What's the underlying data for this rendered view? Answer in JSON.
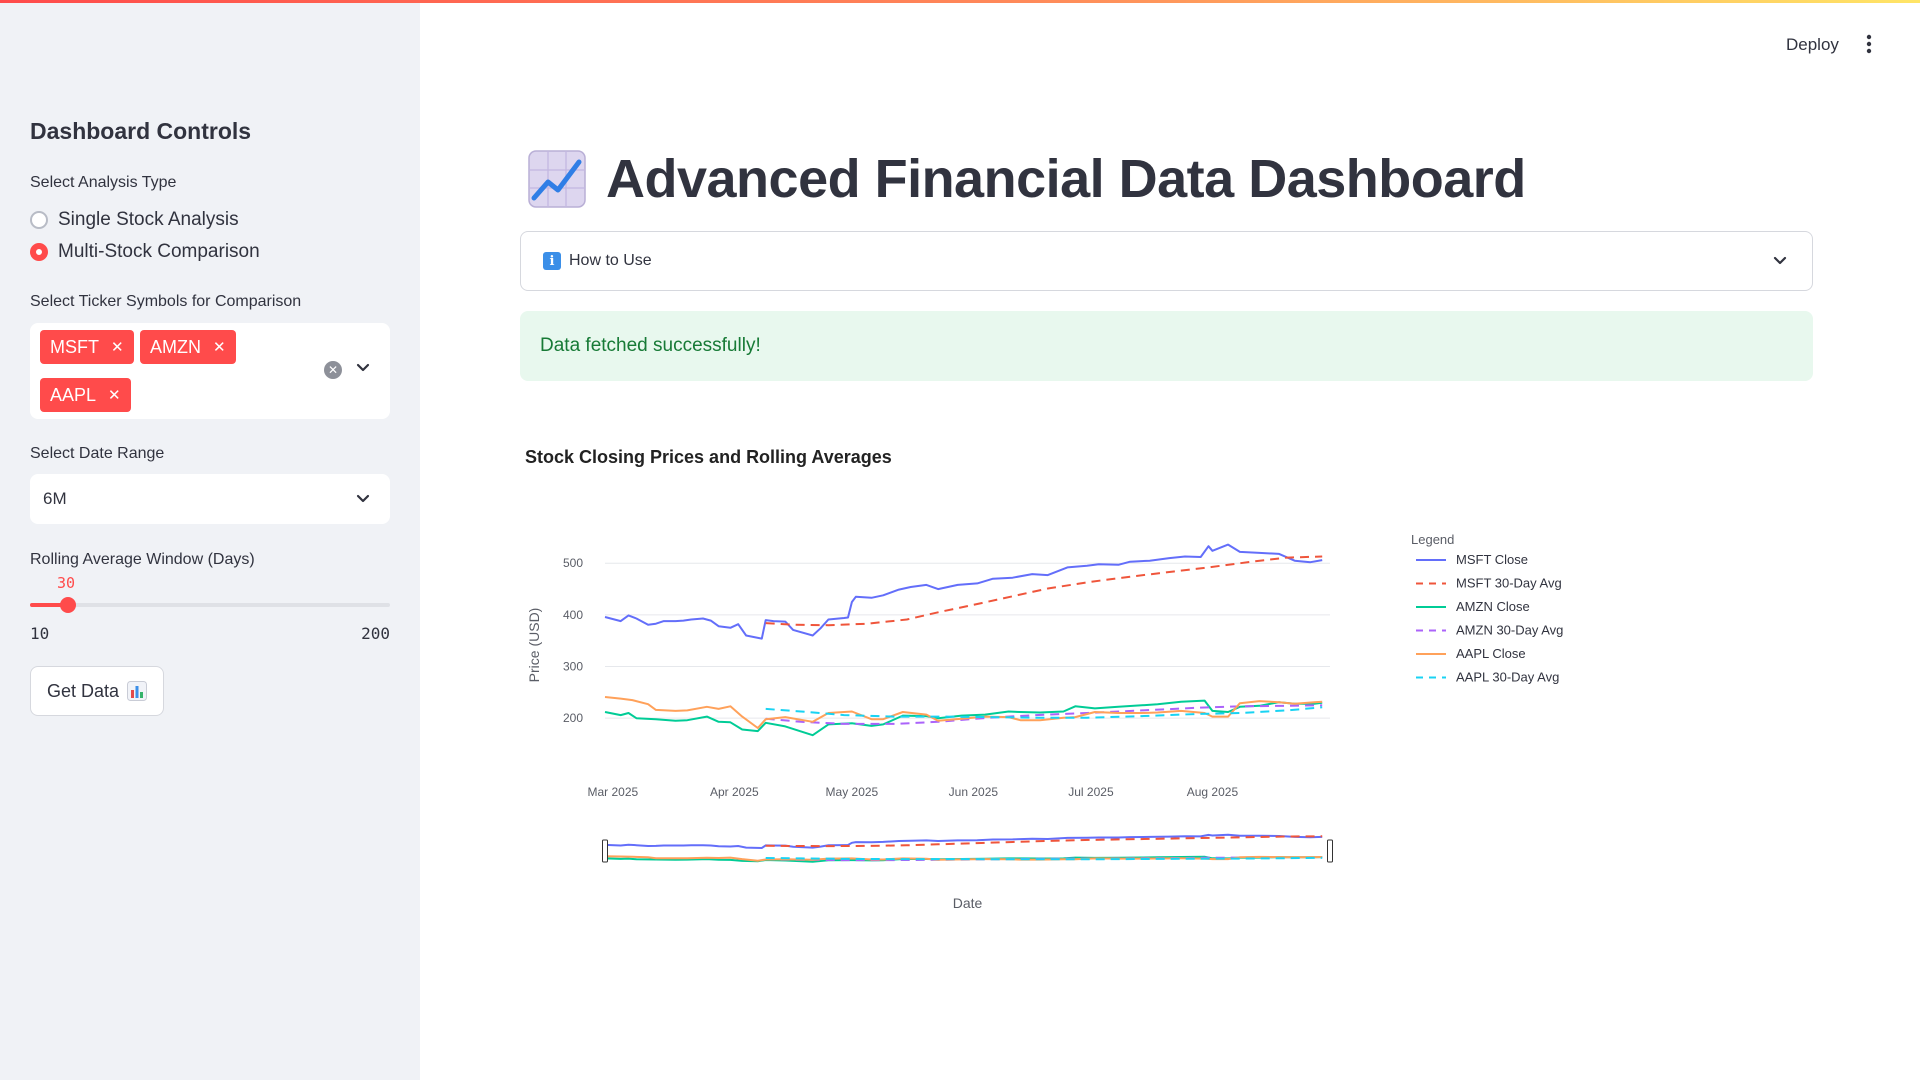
{
  "sidebar": {
    "title": "Dashboard Controls",
    "analysis_label": "Select Analysis Type",
    "analysis_options": [
      "Single Stock Analysis",
      "Multi-Stock Comparison"
    ],
    "analysis_selected": "Multi-Stock Comparison",
    "ticker_label": "Select Ticker Symbols for Comparison",
    "tickers": [
      "MSFT",
      "AMZN",
      "AAPL"
    ],
    "tag_remove_glyph": "✕",
    "clear_glyph": "✕",
    "date_range_label": "Select Date Range",
    "date_range_value": "6M",
    "rolling_label": "Rolling Average Window (Days)",
    "rolling_value": "30",
    "rolling_min": "10",
    "rolling_max": "200",
    "button_label": "Get Data",
    "button_icon": "bar-chart-icon"
  },
  "header": {
    "deploy_label": "Deploy",
    "menu_icon": "kebab-menu-icon"
  },
  "main": {
    "title": "Advanced Financial Data Dashboard",
    "title_icon": "chart-increasing-icon",
    "expander_label": "How to Use",
    "expander_info_glyph": "i",
    "success_message": "Data fetched successfully!",
    "chart_title": "Stock Closing Prices and Rolling Averages"
  },
  "colors": {
    "accent": "#ff4b4b",
    "sidebar_bg": "#f0f2f6",
    "success_bg": "#e8f8ee",
    "success_text": "#177a36",
    "msft": "#636efa",
    "msft_avg": "#ef553b",
    "amzn": "#00cc96",
    "amzn_avg": "#ab63fa",
    "aapl": "#ffa15a",
    "aapl_avg": "#19d3f3"
  },
  "chart_data": {
    "type": "line",
    "title": "Stock Closing Prices and Rolling Averages",
    "xlabel": "Date",
    "ylabel": "Price (USD)",
    "x_ticks": [
      "Mar 2025",
      "Apr 2025",
      "May 2025",
      "Jun 2025",
      "Jul 2025",
      "Aug 2025"
    ],
    "y_ticks": [
      200,
      300,
      400,
      500
    ],
    "ylim": [
      150,
      545
    ],
    "xlim": [
      "2025-02-27",
      "2025-08-31"
    ],
    "grid": true,
    "legend_title": "Legend",
    "legend_position": "right",
    "range_slider": true,
    "series": [
      {
        "name": "MSFT Close",
        "dash": false,
        "color": "#636efa",
        "points": [
          [
            "2025-02-27",
            396
          ],
          [
            "2025-03-03",
            388
          ],
          [
            "2025-03-05",
            399
          ],
          [
            "2025-03-07",
            393
          ],
          [
            "2025-03-10",
            381
          ],
          [
            "2025-03-12",
            383
          ],
          [
            "2025-03-14",
            388
          ],
          [
            "2025-03-17",
            388
          ],
          [
            "2025-03-19",
            389
          ],
          [
            "2025-03-21",
            391
          ],
          [
            "2025-03-24",
            393
          ],
          [
            "2025-03-26",
            389
          ],
          [
            "2025-03-28",
            378
          ],
          [
            "2025-03-31",
            375
          ],
          [
            "2025-04-02",
            382
          ],
          [
            "2025-04-04",
            360
          ],
          [
            "2025-04-08",
            354
          ],
          [
            "2025-04-09",
            390
          ],
          [
            "2025-04-11",
            388
          ],
          [
            "2025-04-14",
            387
          ],
          [
            "2025-04-16",
            371
          ],
          [
            "2025-04-21",
            360
          ],
          [
            "2025-04-23",
            374
          ],
          [
            "2025-04-25",
            391
          ],
          [
            "2025-04-29",
            394
          ],
          [
            "2025-04-30",
            395
          ],
          [
            "2025-05-01",
            425
          ],
          [
            "2025-05-02",
            435
          ],
          [
            "2025-05-06",
            433
          ],
          [
            "2025-05-09",
            438
          ],
          [
            "2025-05-13",
            449
          ],
          [
            "2025-05-16",
            454
          ],
          [
            "2025-05-20",
            458
          ],
          [
            "2025-05-23",
            450
          ],
          [
            "2025-05-28",
            458
          ],
          [
            "2025-06-02",
            461
          ],
          [
            "2025-06-06",
            470
          ],
          [
            "2025-06-11",
            472
          ],
          [
            "2025-06-16",
            479
          ],
          [
            "2025-06-20",
            477
          ],
          [
            "2025-06-25",
            492
          ],
          [
            "2025-06-30",
            495
          ],
          [
            "2025-07-03",
            498
          ],
          [
            "2025-07-08",
            497
          ],
          [
            "2025-07-11",
            503
          ],
          [
            "2025-07-16",
            505
          ],
          [
            "2025-07-21",
            510
          ],
          [
            "2025-07-25",
            513
          ],
          [
            "2025-07-29",
            512
          ],
          [
            "2025-07-31",
            533
          ],
          [
            "2025-08-01",
            524
          ],
          [
            "2025-08-05",
            536
          ],
          [
            "2025-08-08",
            522
          ],
          [
            "2025-08-13",
            520
          ],
          [
            "2025-08-18",
            518
          ],
          [
            "2025-08-22",
            505
          ],
          [
            "2025-08-26",
            502
          ],
          [
            "2025-08-29",
            506
          ]
        ]
      },
      {
        "name": "MSFT 30-Day Avg",
        "dash": true,
        "color": "#ef553b",
        "points": [
          [
            "2025-04-09",
            384
          ],
          [
            "2025-04-16",
            381
          ],
          [
            "2025-04-25",
            380
          ],
          [
            "2025-05-05",
            383
          ],
          [
            "2025-05-15",
            391
          ],
          [
            "2025-05-23",
            405
          ],
          [
            "2025-06-02",
            421
          ],
          [
            "2025-06-11",
            436
          ],
          [
            "2025-06-20",
            451
          ],
          [
            "2025-07-01",
            464
          ],
          [
            "2025-07-10",
            473
          ],
          [
            "2025-07-21",
            483
          ],
          [
            "2025-07-31",
            492
          ],
          [
            "2025-08-11",
            503
          ],
          [
            "2025-08-20",
            511
          ],
          [
            "2025-08-29",
            513
          ]
        ]
      },
      {
        "name": "AMZN Close",
        "dash": false,
        "color": "#00cc96",
        "points": [
          [
            "2025-02-27",
            212
          ],
          [
            "2025-03-03",
            206
          ],
          [
            "2025-03-05",
            210
          ],
          [
            "2025-03-07",
            200
          ],
          [
            "2025-03-12",
            198
          ],
          [
            "2025-03-17",
            195
          ],
          [
            "2025-03-20",
            196
          ],
          [
            "2025-03-25",
            203
          ],
          [
            "2025-03-28",
            193
          ],
          [
            "2025-03-31",
            192
          ],
          [
            "2025-04-03",
            178
          ],
          [
            "2025-04-07",
            175
          ],
          [
            "2025-04-09",
            191
          ],
          [
            "2025-04-14",
            184
          ],
          [
            "2025-04-21",
            167
          ],
          [
            "2025-04-25",
            188
          ],
          [
            "2025-05-01",
            190
          ],
          [
            "2025-05-06",
            185
          ],
          [
            "2025-05-09",
            188
          ],
          [
            "2025-05-14",
            205
          ],
          [
            "2025-05-20",
            204
          ],
          [
            "2025-05-23",
            200
          ],
          [
            "2025-05-29",
            205
          ],
          [
            "2025-06-04",
            207
          ],
          [
            "2025-06-10",
            213
          ],
          [
            "2025-06-13",
            212
          ],
          [
            "2025-06-18",
            211
          ],
          [
            "2025-06-24",
            213
          ],
          [
            "2025-06-27",
            223
          ],
          [
            "2025-07-02",
            219
          ],
          [
            "2025-07-08",
            222
          ],
          [
            "2025-07-14",
            225
          ],
          [
            "2025-07-18",
            227
          ],
          [
            "2025-07-24",
            232
          ],
          [
            "2025-07-30",
            234
          ],
          [
            "2025-08-01",
            214
          ],
          [
            "2025-08-05",
            212
          ],
          [
            "2025-08-08",
            222
          ],
          [
            "2025-08-13",
            224
          ],
          [
            "2025-08-18",
            231
          ],
          [
            "2025-08-22",
            228
          ],
          [
            "2025-08-27",
            228
          ],
          [
            "2025-08-29",
            230
          ]
        ]
      },
      {
        "name": "AMZN 30-Day Avg",
        "dash": true,
        "color": "#ab63fa",
        "points": [
          [
            "2025-04-09",
            199
          ],
          [
            "2025-04-18",
            193
          ],
          [
            "2025-04-29",
            189
          ],
          [
            "2025-05-12",
            189
          ],
          [
            "2025-05-23",
            193
          ],
          [
            "2025-06-05",
            201
          ],
          [
            "2025-06-17",
            206
          ],
          [
            "2025-06-30",
            210
          ],
          [
            "2025-07-14",
            215
          ],
          [
            "2025-07-28",
            220
          ],
          [
            "2025-08-08",
            223
          ],
          [
            "2025-08-20",
            224
          ],
          [
            "2025-08-29",
            225
          ]
        ]
      },
      {
        "name": "AAPL Close",
        "dash": false,
        "color": "#ffa15a",
        "points": [
          [
            "2025-02-27",
            241
          ],
          [
            "2025-03-03",
            238
          ],
          [
            "2025-03-06",
            235
          ],
          [
            "2025-03-10",
            227
          ],
          [
            "2025-03-12",
            216
          ],
          [
            "2025-03-17",
            214
          ],
          [
            "2025-03-20",
            215
          ],
          [
            "2025-03-25",
            222
          ],
          [
            "2025-03-28",
            218
          ],
          [
            "2025-03-31",
            223
          ],
          [
            "2025-04-03",
            203
          ],
          [
            "2025-04-07",
            181
          ],
          [
            "2025-04-09",
            198
          ],
          [
            "2025-04-14",
            202
          ],
          [
            "2025-04-21",
            193
          ],
          [
            "2025-04-25",
            210
          ],
          [
            "2025-05-01",
            213
          ],
          [
            "2025-05-06",
            198
          ],
          [
            "2025-05-09",
            198
          ],
          [
            "2025-05-14",
            212
          ],
          [
            "2025-05-20",
            207
          ],
          [
            "2025-05-23",
            195
          ],
          [
            "2025-05-29",
            199
          ],
          [
            "2025-06-04",
            203
          ],
          [
            "2025-06-10",
            202
          ],
          [
            "2025-06-13",
            196
          ],
          [
            "2025-06-18",
            196
          ],
          [
            "2025-06-24",
            201
          ],
          [
            "2025-06-27",
            202
          ],
          [
            "2025-07-02",
            212
          ],
          [
            "2025-07-08",
            210
          ],
          [
            "2025-07-14",
            210
          ],
          [
            "2025-07-18",
            211
          ],
          [
            "2025-07-24",
            214
          ],
          [
            "2025-07-30",
            210
          ],
          [
            "2025-08-01",
            203
          ],
          [
            "2025-08-05",
            203
          ],
          [
            "2025-08-08",
            229
          ],
          [
            "2025-08-13",
            233
          ],
          [
            "2025-08-18",
            231
          ],
          [
            "2025-08-22",
            228
          ],
          [
            "2025-08-27",
            231
          ],
          [
            "2025-08-29",
            232
          ]
        ]
      },
      {
        "name": "AAPL 30-Day Avg",
        "dash": true,
        "color": "#19d3f3",
        "points": [
          [
            "2025-04-09",
            218
          ],
          [
            "2025-04-18",
            213
          ],
          [
            "2025-04-29",
            206
          ],
          [
            "2025-05-12",
            203
          ],
          [
            "2025-05-23",
            203
          ],
          [
            "2025-06-05",
            202
          ],
          [
            "2025-06-17",
            201
          ],
          [
            "2025-06-30",
            201
          ],
          [
            "2025-07-14",
            204
          ],
          [
            "2025-07-28",
            208
          ],
          [
            "2025-08-08",
            210
          ],
          [
            "2025-08-20",
            215
          ],
          [
            "2025-08-29",
            221
          ]
        ]
      }
    ]
  }
}
